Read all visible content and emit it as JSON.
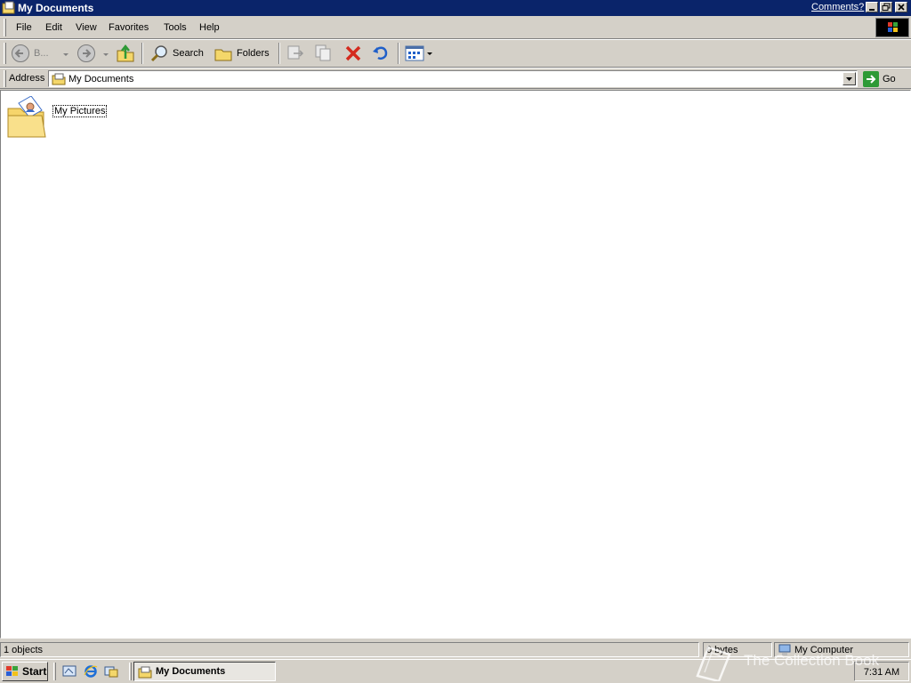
{
  "window": {
    "title": "My Documents",
    "comments_link": "Comments?"
  },
  "menu": [
    "File",
    "Edit",
    "View",
    "Favorites",
    "Tools",
    "Help"
  ],
  "toolbar": {
    "back_label": "B...",
    "search_label": "Search",
    "folders_label": "Folders"
  },
  "address": {
    "label": "Address",
    "value": "My Documents",
    "go_label": "Go"
  },
  "content": {
    "items": [
      {
        "label": "My Pictures",
        "icon": "my-pictures-folder-icon"
      }
    ]
  },
  "status": {
    "objects": "1 objects",
    "size": "0 bytes",
    "zone": "My Computer"
  },
  "taskbar": {
    "start_label": "Start",
    "active_window": "My Documents",
    "clock": "7:31 AM"
  },
  "watermark": "The Collection Book",
  "colors": {
    "title_bar": "#0a246a",
    "chrome": "#d4d0c8",
    "content_bg": "#ffffff",
    "delete_red": "#d42a1e",
    "go_green": "#2e9a36"
  }
}
